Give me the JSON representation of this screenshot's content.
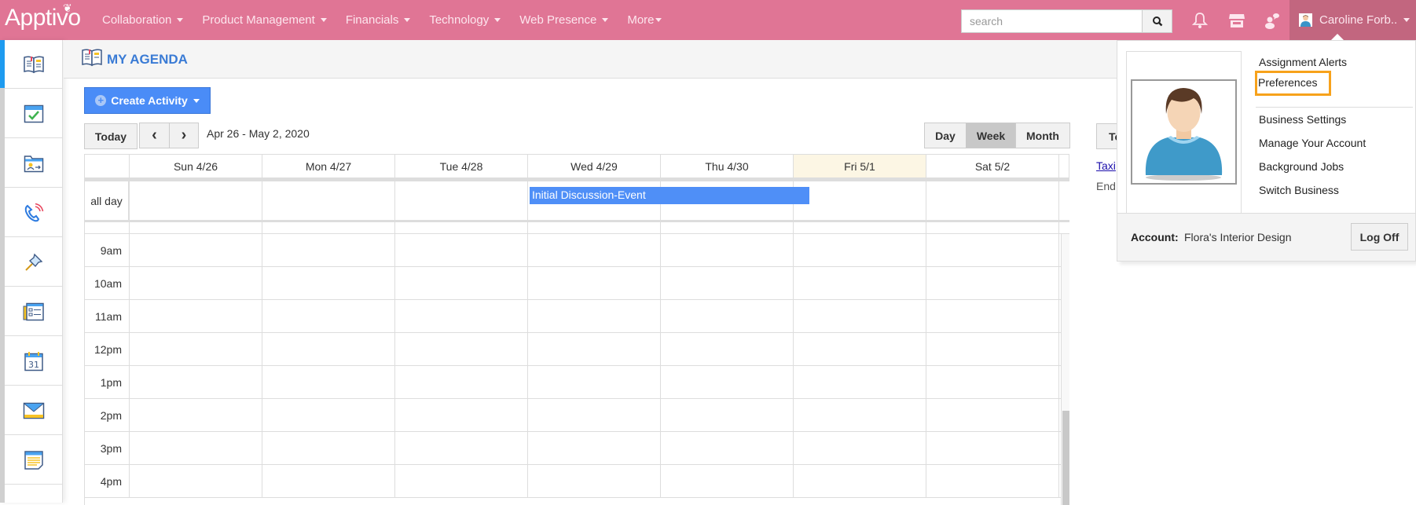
{
  "app": {
    "brand": "Apptivo"
  },
  "nav": [
    {
      "label": "Collaboration"
    },
    {
      "label": "Product Management"
    },
    {
      "label": "Financials"
    },
    {
      "label": "Technology"
    },
    {
      "label": "Web Presence"
    },
    {
      "label": "More"
    }
  ],
  "search": {
    "placeholder": "search",
    "value": ""
  },
  "top_icons": [
    "bell-icon",
    "store-icon",
    "chat-users-icon"
  ],
  "user": {
    "name": "Caroline Forb.."
  },
  "sidebar": {
    "items": [
      {
        "name": "agenda",
        "icon": "open-book-icon",
        "active": true
      },
      {
        "name": "tasks",
        "icon": "calendar-check-icon"
      },
      {
        "name": "contacts-folder",
        "icon": "contact-folder-icon"
      },
      {
        "name": "calls",
        "icon": "phone-icon"
      },
      {
        "name": "pins",
        "icon": "pushpin-icon"
      },
      {
        "name": "forms",
        "icon": "list-form-icon"
      },
      {
        "name": "calendar",
        "icon": "calendar-31-icon",
        "day": "31"
      },
      {
        "name": "email",
        "icon": "envelope-icon"
      },
      {
        "name": "notes",
        "icon": "notepad-icon"
      }
    ]
  },
  "page": {
    "title": "MY AGENDA"
  },
  "toolbar": {
    "create_label": "Create Activity",
    "today_label": "Today",
    "prev": "‹",
    "next": "›",
    "range": "Apr 26 - May 2, 2020",
    "views": [
      {
        "label": "Day",
        "active": false
      },
      {
        "label": "Week",
        "active": true
      },
      {
        "label": "Month",
        "active": false
      }
    ]
  },
  "calendar": {
    "days": [
      {
        "label": "Sun 4/26",
        "today": false
      },
      {
        "label": "Mon 4/27",
        "today": false
      },
      {
        "label": "Tue 4/28",
        "today": false
      },
      {
        "label": "Wed 4/29",
        "today": false
      },
      {
        "label": "Thu 4/30",
        "today": false
      },
      {
        "label": "Fri 5/1",
        "today": true
      },
      {
        "label": "Sat 5/2",
        "today": false
      }
    ],
    "allday_label": "all day",
    "allday_events": [
      {
        "title": "Initial Discussion-Event",
        "start_day": "Wed 4/29",
        "end_day": "Thu 4/30",
        "color": "#4f8ff7"
      }
    ],
    "hours": [
      "9am",
      "10am",
      "11am",
      "12pm",
      "1pm",
      "2pm",
      "3pm",
      "4pm"
    ]
  },
  "right_panel_peek": {
    "button": "To",
    "link": "Taxi",
    "text": "End"
  },
  "user_dropdown": {
    "links": [
      {
        "label": "Assignment Alerts",
        "highlighted": false
      },
      {
        "label": "Preferences",
        "highlighted": true
      },
      {
        "label": "Business Settings",
        "highlighted": false
      },
      {
        "label": "Manage Your Account",
        "highlighted": false
      },
      {
        "label": "Background Jobs",
        "highlighted": false
      },
      {
        "label": "Switch Business",
        "highlighted": false
      }
    ],
    "account_label": "Account:",
    "account_value": "Flora's Interior Design",
    "logoff_label": "Log Off"
  },
  "colors": {
    "topbar": "#e07595",
    "user_menu": "#c2667f",
    "accent_blue": "#4a8cf7",
    "highlight": "#f7a21b",
    "today_bg": "#fcf6e4"
  }
}
